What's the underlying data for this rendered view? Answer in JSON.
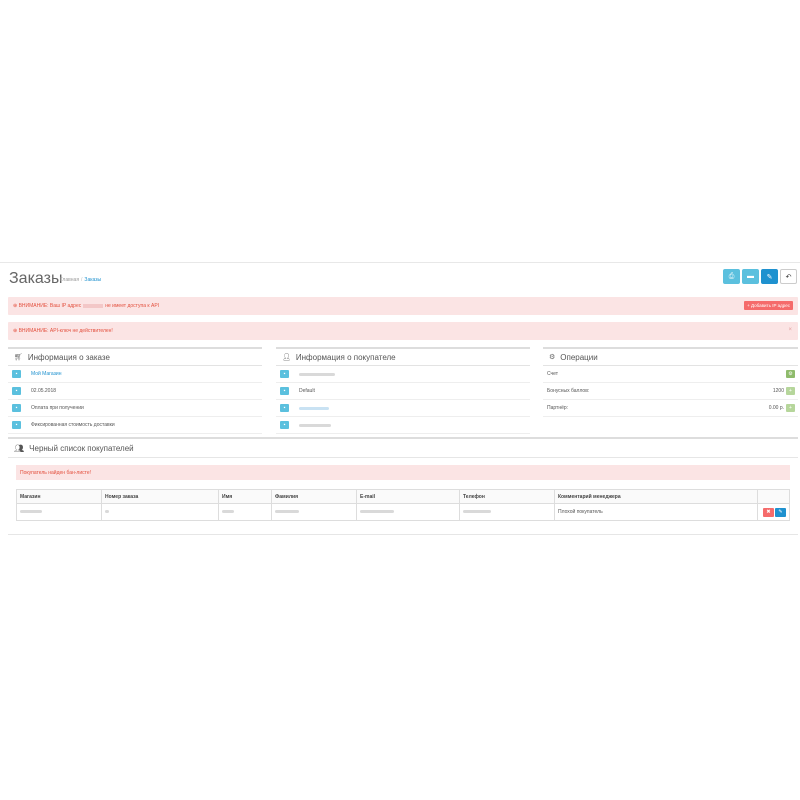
{
  "header": {
    "title": "Заказы",
    "breadcrumb": [
      "Главная",
      "Заказы"
    ],
    "buttons": [
      {
        "icon": "print-icon",
        "glyph": "⎙"
      },
      {
        "icon": "truck-icon",
        "glyph": "▬"
      },
      {
        "icon": "pencil-icon",
        "glyph": "✎"
      },
      {
        "icon": "reply-icon",
        "glyph": "↶"
      }
    ]
  },
  "alerts": {
    "ip_warning_prefix": "⊕ ВНИМАНИЕ: Ваш IP адрес",
    "ip_warning_suffix": "не имеет доступа к API",
    "add_ip_button": "+ Добавить IP адрес",
    "api_key_warning": "⊕ ВНИМАНИЕ: API-ключ не действителен!",
    "close": "×"
  },
  "order_info": {
    "title": "Информация о заказе",
    "store": "Мой Магазин",
    "date": "02.05.2018",
    "payment": "Оплата при получении",
    "shipping": "Фиксированная стоимость доставки"
  },
  "customer_info": {
    "title": "Информация о покупателе",
    "group": "Default"
  },
  "operations": {
    "title": "Операции",
    "rows": [
      {
        "label": "Счет",
        "value": ""
      },
      {
        "label": "Бонусных баллов:",
        "value": "1200"
      },
      {
        "label": "Партнёр:",
        "value": "0.00 р."
      }
    ]
  },
  "blacklist": {
    "title": "Черный список покупателей",
    "alert": "Покупатель найден бан-листе!",
    "columns": [
      "Магазин",
      "Номер заказа",
      "Имя",
      "Фамилия",
      "E-mail",
      "Телефон",
      "Комментарий менеджера"
    ],
    "row": {
      "comment": "Плохой покупатель"
    }
  }
}
